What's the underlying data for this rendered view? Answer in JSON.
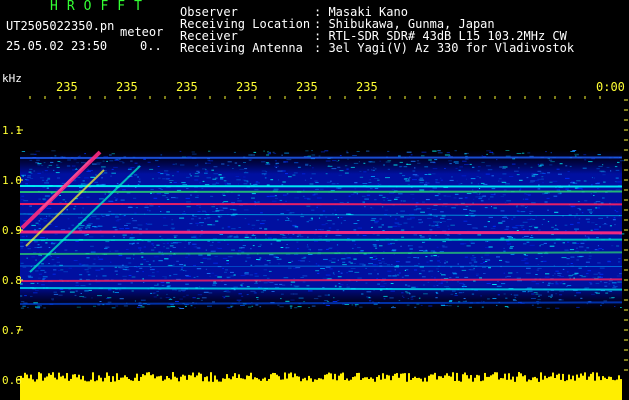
{
  "header": {
    "app_title": "HROFFT",
    "filename": "UT2505022350.pn",
    "mode": "meteor",
    "datetime": "25.05.02 23:50",
    "counter": "0.."
  },
  "info": [
    {
      "label": "Observer",
      "value": ": Masaki Kano"
    },
    {
      "label": "Receiving Location",
      "value": ": Shibukawa, Gunma, Japan"
    },
    {
      "label": "Receiver",
      "value": ": RTL-SDR SDR# 43dB L15 103.2MHz CW"
    },
    {
      "label": "Receiving Antenna",
      "value": ": 3el Yagi(V) Az 330 for Vladivostok"
    }
  ],
  "axis": {
    "unit": "kHz",
    "y_ticks": [
      "1.1",
      "1.0",
      "0.9",
      "0.8",
      "0.7",
      "0.6"
    ],
    "x_ticks": [
      "235",
      "235",
      "235",
      "235",
      "235",
      "235"
    ],
    "x_end": "0:00"
  },
  "colors": {
    "background": "#000000",
    "text": "#ffffff",
    "axis": "#ffff33",
    "title": "#33ff33",
    "noise": "#ffee00"
  }
}
